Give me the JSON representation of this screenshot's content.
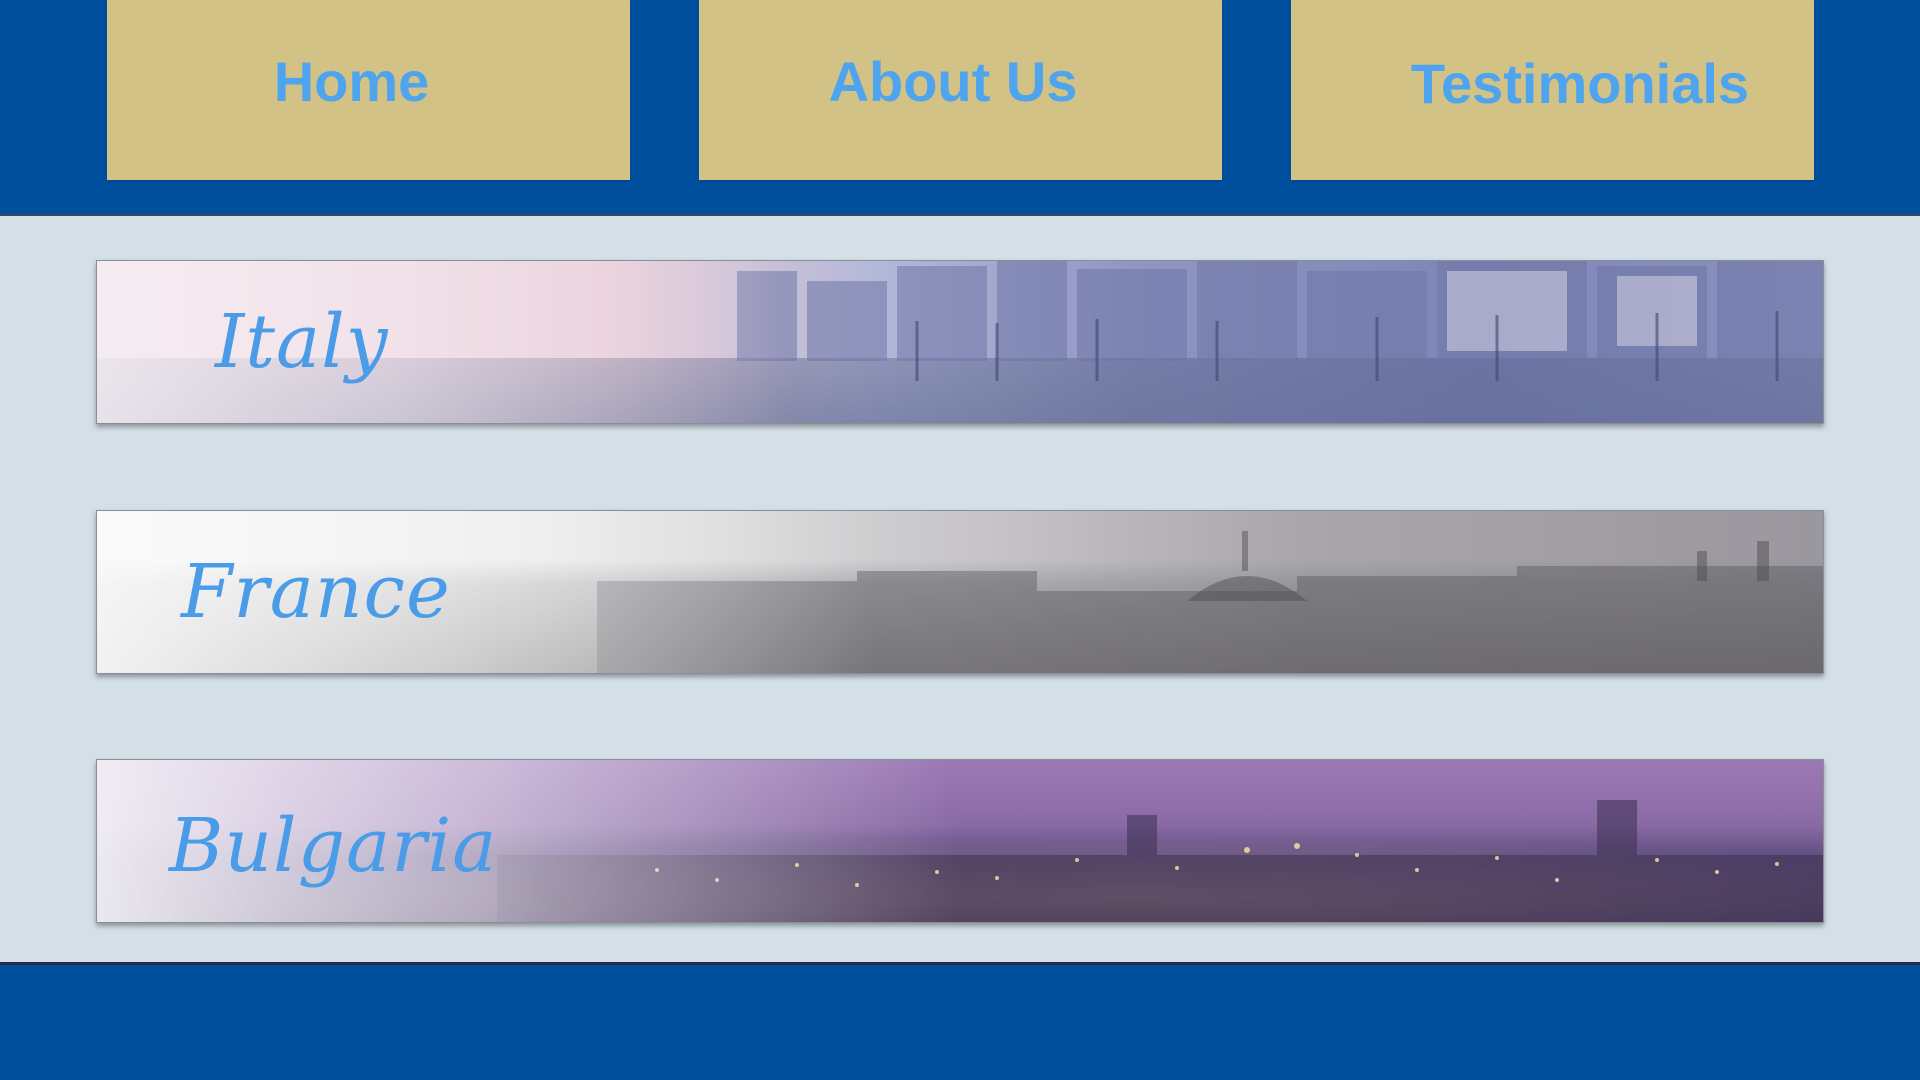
{
  "nav": {
    "home_label": "Home",
    "about_label": "About Us",
    "testimonials_label": "Testimonials"
  },
  "destinations": [
    {
      "label": "Italy",
      "scene_icon": "venice-canal-image"
    },
    {
      "label": "France",
      "scene_icon": "paris-skyline-image"
    },
    {
      "label": "Bulgaria",
      "scene_icon": "city-night-lights-image"
    }
  ],
  "colors": {
    "header_bg": "#00509e",
    "tab_bg": "#d2c286",
    "tab_text": "#4ea4ee",
    "page_bg": "#d5dfe8",
    "banner_text": "#4a9be8"
  }
}
